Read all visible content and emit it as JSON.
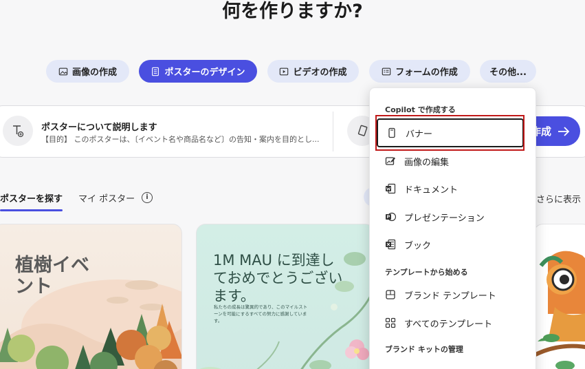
{
  "page": {
    "title": "何を作りますか?"
  },
  "chips": [
    {
      "label": "画像の作成",
      "icon": "image-icon"
    },
    {
      "label": "ポスターのデザイン",
      "icon": "document-icon"
    },
    {
      "label": "ビデオの作成",
      "icon": "video-icon"
    },
    {
      "label": "フォームの作成",
      "icon": "form-icon"
    },
    {
      "label": "その他..."
    }
  ],
  "prompt": {
    "title": "ポスターについて説明します",
    "subtitle": "【目的】 このポスターは、〔イベント名や商品名など〕の告知・案内を目的とし...",
    "create_label": "作成"
  },
  "tabs": [
    {
      "label": "ポスターを探す"
    },
    {
      "label": "マイ ポスター"
    }
  ],
  "show_more": "さらに表示",
  "cards": [
    {
      "title": "植樹イベント"
    },
    {
      "title": "1M MAU に到達しておめでとうございます。",
      "body": "私たちの成長は驚異的であり、このマイルストーンを可能にするすべての努力に感謝しています。"
    }
  ],
  "menu": {
    "section1": "Copilot で作成する",
    "section2": "テンプレートから始める",
    "section3": "ブランド キットの管理",
    "items": [
      {
        "label": "バナー",
        "icon": "banner-icon"
      },
      {
        "label": "画像の編集",
        "icon": "image-edit-icon"
      },
      {
        "label": "ドキュメント",
        "icon": "word-icon"
      },
      {
        "label": "プレゼンテーション",
        "icon": "powerpoint-icon"
      },
      {
        "label": "ブック",
        "icon": "excel-icon"
      },
      {
        "label": "ブランド テンプレート",
        "icon": "brand-template-icon"
      },
      {
        "label": "すべてのテンプレート",
        "icon": "grid-icon"
      }
    ]
  },
  "colors": {
    "accent": "#4a4fe0",
    "chip_bg": "#e3e8f8",
    "highlight": "#c01818"
  }
}
